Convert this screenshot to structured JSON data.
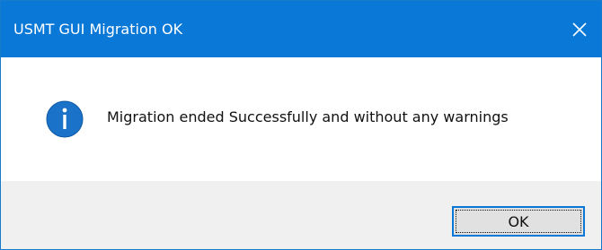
{
  "window": {
    "title": "USMT GUI Migration OK",
    "close_icon": "close-icon"
  },
  "content": {
    "icon": "info-icon",
    "message": "Migration ended Successfully and without any warnings"
  },
  "footer": {
    "ok_label": "OK"
  },
  "colors": {
    "titlebar": "#0a78d7",
    "title_text": "#ffffff",
    "info_icon": "#1a73c8",
    "footer_bg": "#f0f0f0",
    "button_bg": "#e1e1e1",
    "button_border": "#0a78d7"
  }
}
